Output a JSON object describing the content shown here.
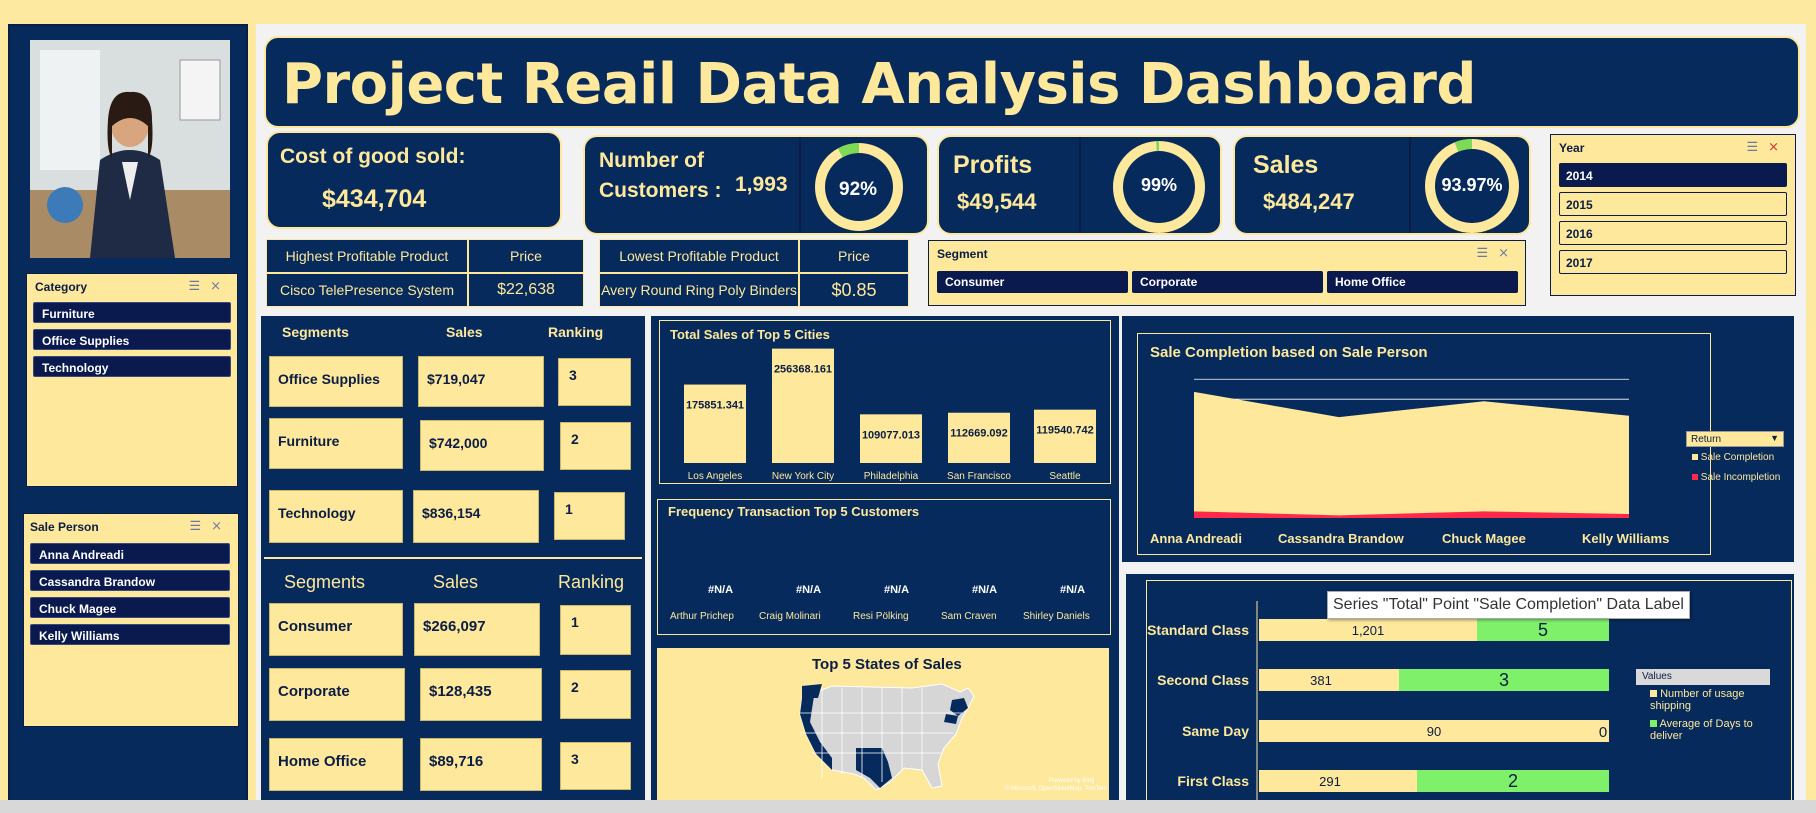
{
  "title": "Project Reail Data Analysis Dashboard",
  "kpis": {
    "cogs_label": "Cost of good sold:",
    "cogs_value": "$434,704",
    "customers_label_1": "Number of",
    "customers_label_2": "Customers :",
    "customers_value": "1,993",
    "customers_pct": "92%",
    "customers_fraction": 0.92,
    "profits_label": "Profits",
    "profits_value": "$49,544",
    "profits_pct": "99%",
    "profits_fraction": 0.99,
    "sales_label": "Sales",
    "sales_value": "$484,247",
    "sales_pct": "93.97%",
    "sales_fraction": 0.9397
  },
  "category_slicer": {
    "title": "Category",
    "items": [
      "Furniture",
      "Office Supplies",
      "Technology"
    ]
  },
  "salesperson_slicer": {
    "title": "Sale Person",
    "items": [
      "Anna Andreadi",
      "Cassandra Brandow",
      "Chuck Magee",
      "Kelly Williams"
    ]
  },
  "year_slicer": {
    "title": "Year",
    "items": [
      "2014",
      "2015",
      "2016",
      "2017"
    ],
    "selected": "2014"
  },
  "segment_slicer": {
    "title": "Segment",
    "items": [
      "Consumer",
      "Corporate",
      "Home Office"
    ]
  },
  "highest_product": {
    "h1": "Highest Profitable Product",
    "h2": "Price",
    "name": "Cisco TelePresence System",
    "price": "$22,638"
  },
  "lowest_product": {
    "h1": "Lowest Profitable Product",
    "h2": "Price",
    "name": "Avery Round Ring Poly Binders",
    "price": "$0.85"
  },
  "category_table": {
    "headers": [
      "Segments",
      "Sales",
      "Ranking"
    ],
    "rows": [
      {
        "name": "Office Supplies",
        "sales": "$719,047",
        "rank": "3"
      },
      {
        "name": "Furniture",
        "sales": "$742,000",
        "rank": "2"
      },
      {
        "name": "Technology",
        "sales": "$836,154",
        "rank": "1"
      }
    ]
  },
  "segment_table": {
    "headers": [
      "Segments",
      "Sales",
      "Ranking"
    ],
    "rows": [
      {
        "name": "Consumer",
        "sales": "$266,097",
        "rank": "1"
      },
      {
        "name": "Corporate",
        "sales": "$128,435",
        "rank": "2"
      },
      {
        "name": "Home Office",
        "sales": "$89,716",
        "rank": "3"
      }
    ]
  },
  "top_cities": {
    "title": "Total Sales of Top 5  Cities",
    "cities": [
      "Los Angeles",
      "New York City",
      "Philadelphia",
      "San Francisco",
      "Seattle"
    ],
    "values": [
      175851.341,
      256368.161,
      109077.013,
      112669.092,
      119540.742
    ],
    "labels": [
      "175851.341",
      "256368.161",
      "109077.013",
      "112669.092",
      "119540.742"
    ]
  },
  "freq_customers": {
    "title": "Frequency Transaction  Top 5 Customers",
    "customers": [
      "Arthur Prichep",
      "Craig Molinari",
      "Resi Pölking",
      "Sam Craven",
      "Shirley Daniels"
    ],
    "values": [
      "#N/A",
      "#N/A",
      "#N/A",
      "#N/A",
      "#N/A"
    ]
  },
  "states_map": {
    "title": "Top 5 States of Sales",
    "credit_1": "Powered by Bing",
    "credit_2": "© Microsoft, OpenStreetMap, TomTom"
  },
  "sale_completion": {
    "title": "Sale Completion based on Sale Person",
    "people": [
      "Anna Andreadi",
      "Cassandra Brandow",
      "Chuck Magee",
      "Kelly Williams"
    ],
    "legend_filter": "Return",
    "legend": [
      "Sale Completion",
      "Sale Incompletion"
    ],
    "colors": [
      "#fde89b",
      "#ff2a4a"
    ]
  },
  "chart_data": [
    {
      "type": "bar",
      "title": "Total Sales of Top 5  Cities",
      "categories": [
        "Los Angeles",
        "New York City",
        "Philadelphia",
        "San Francisco",
        "Seattle"
      ],
      "values": [
        175851.341,
        256368.161,
        109077.013,
        112669.092,
        119540.742
      ]
    },
    {
      "type": "area",
      "title": "Sale Completion based on Sale Person",
      "categories": [
        "Anna Andreadi",
        "Cassandra Brandow",
        "Chuck Magee",
        "Kelly Williams"
      ],
      "series": [
        {
          "name": "Sale Completion",
          "values": [
            95,
            76,
            88,
            77
          ]
        },
        {
          "name": "Sale Incompletion",
          "values": [
            5,
            2,
            5,
            3
          ]
        }
      ],
      "ylim": [
        0,
        110
      ]
    },
    {
      "type": "bar",
      "categories": [
        "Standard Class",
        "Second Class",
        "Same Day",
        "First Class"
      ],
      "series": [
        {
          "name": "Number of usage shipping",
          "values": [
            1201,
            381,
            90,
            291
          ]
        },
        {
          "name": "Average of Days to deliver",
          "values": [
            5,
            3,
            0,
            2
          ]
        }
      ]
    }
  ],
  "shipping": {
    "classes": [
      "Standard Class",
      "Second Class",
      "Same Day",
      "First Class"
    ],
    "usage": [
      "1,201",
      "381",
      "90",
      "291"
    ],
    "avg_days": [
      "5",
      "3",
      "0",
      "2"
    ],
    "legend_title": "Values",
    "legend": [
      "Number of usage shipping",
      "Average of Days to deliver"
    ],
    "colors": [
      "#fde89b",
      "#7ef06a"
    ],
    "tooltip": "Series \"Total\" Point \"Sale Completion\" Data Label"
  }
}
